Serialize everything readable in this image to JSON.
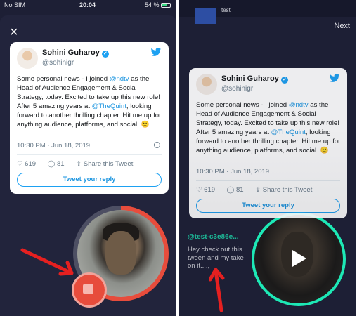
{
  "status_bar": {
    "carrier": "No SIM",
    "time": "20:04",
    "battery": "54 %"
  },
  "left_panel": {
    "close_icon": "close-icon"
  },
  "right_panel": {
    "next_label": "Next",
    "partial_title": "test",
    "username": "@test-c3e86e...",
    "caption": "Hey check out this tween and my take on it....,"
  },
  "tweet": {
    "name": "Sohini Guharoy",
    "handle": "@sohinigr",
    "body_pre": "Some personal news - I joined ",
    "mention1": "@ndtv",
    "body_mid": " as the Head of Audience Engagement & Social Strategy, today. Excited to take up this new role! After 5 amazing years at ",
    "mention2": "@TheQuint",
    "body_post": ", looking forward to another thrilling chapter. Hit me up for anything audience, platforms, and social. 🙂",
    "datetime": "10:30 PM · Jun 18, 2019",
    "likes": "619",
    "replies": "81",
    "share": "Share this Tweet",
    "reply_button": "Tweet your reply"
  },
  "colors": {
    "accent_red": "#e74c3c",
    "accent_teal": "#1de9b6",
    "twitter_blue": "#1da1f2"
  }
}
